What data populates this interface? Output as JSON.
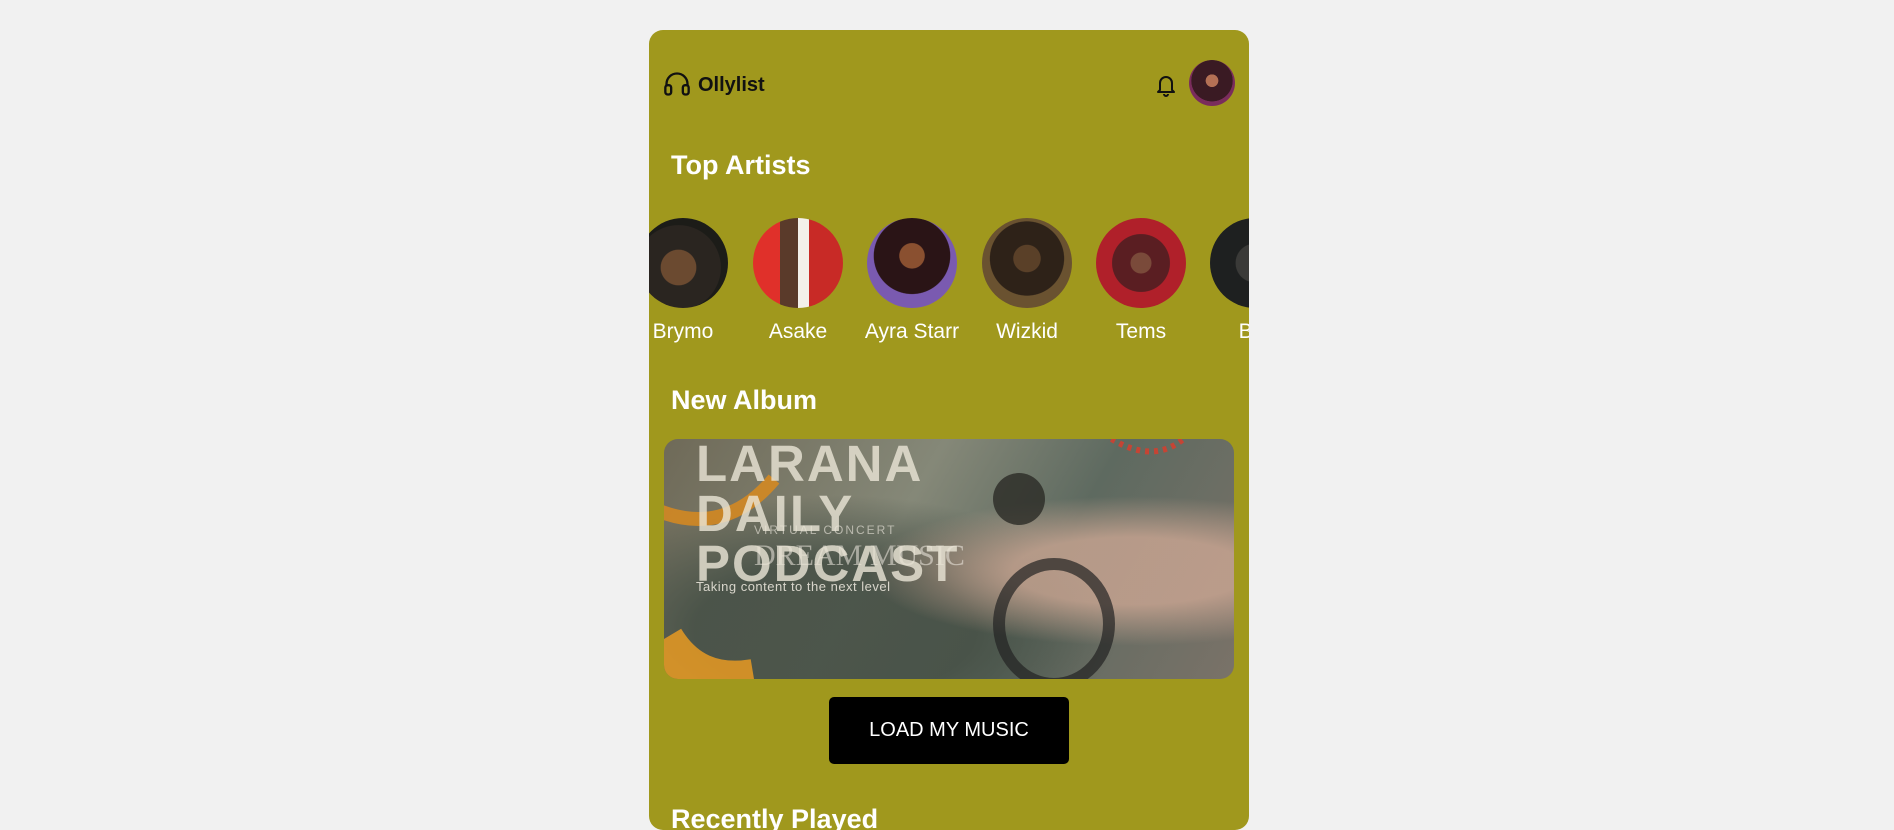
{
  "app": {
    "brand": "Ollylist",
    "theme_color": "#a0981d"
  },
  "header": {
    "logo_icon": "headphones-icon",
    "notification_icon": "bell-icon"
  },
  "top_artists": {
    "title": "Top Artists",
    "items": [
      {
        "name": "Brymo"
      },
      {
        "name": "Asake"
      },
      {
        "name": "Ayra Starr"
      },
      {
        "name": "Wizkid"
      },
      {
        "name": "Tems"
      },
      {
        "name": "Bur"
      }
    ]
  },
  "new_album": {
    "title": "New Album",
    "banner": {
      "headline": "LARANA\nDAILY\nPODCAST",
      "tag": "VIRTUAL CONCERT",
      "script": "DREAM MUSIC",
      "subtitle": "Taking content to the next level"
    }
  },
  "actions": {
    "load_music": "LOAD MY MUSIC"
  },
  "recently_played": {
    "title": "Recently Played"
  }
}
